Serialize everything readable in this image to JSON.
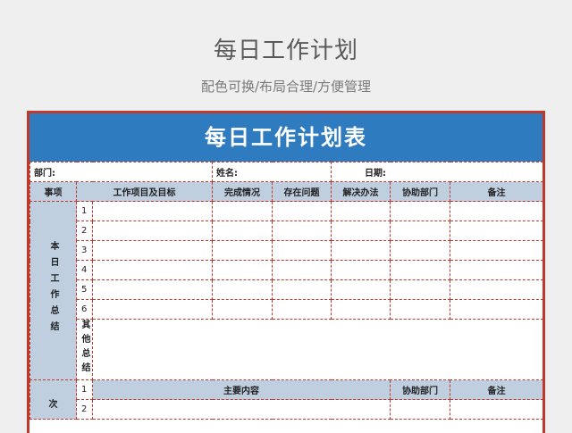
{
  "page": {
    "title": "每日工作计划",
    "subtitle": "配色可换/布局合理/方便管理"
  },
  "sheet": {
    "banner_title": "每日工作计划表",
    "info": {
      "department_label": "部门:",
      "name_label": "姓名:",
      "date_label": "日期:"
    },
    "columns": [
      "事项",
      "工作项目及目标",
      "完成情况",
      "存在问题",
      "解决办法",
      "协助部门",
      "备注"
    ],
    "summary_section": {
      "label": "本日工作总结",
      "rows": [
        "1",
        "2",
        "3",
        "4",
        "5",
        "6"
      ],
      "other_label": "其他总结"
    },
    "next_section": {
      "label": "次",
      "header": {
        "num": "1",
        "main": "主要内容",
        "assist": "协助部门",
        "note": "备注"
      },
      "rows": [
        "2"
      ]
    }
  }
}
